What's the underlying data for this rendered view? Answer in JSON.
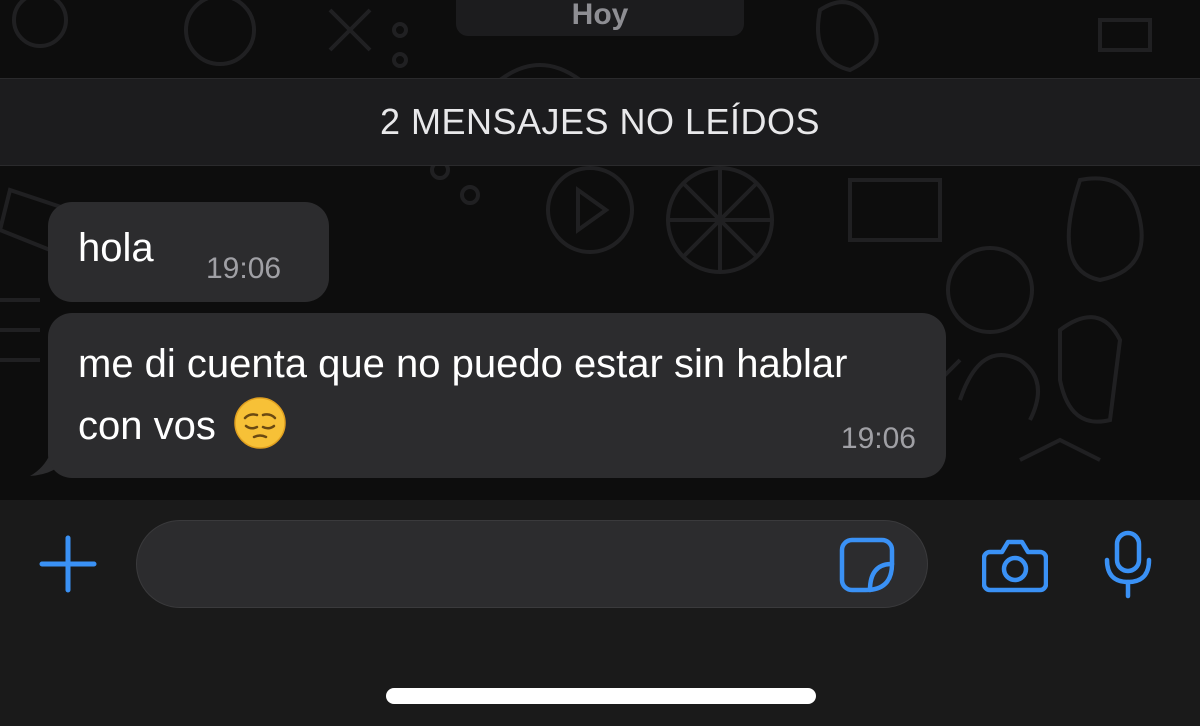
{
  "chat": {
    "date_label": "Hoy",
    "unread_banner": "2 MENSAJES NO LEÍDOS",
    "messages": [
      {
        "text": "hola",
        "time": "19:06",
        "direction": "incoming"
      },
      {
        "text": "me di cuenta que no puedo estar sin hablar con vos",
        "emoji": "pensive-face-emoji",
        "time": "19:06",
        "direction": "incoming"
      }
    ]
  },
  "input_bar": {
    "message_value": "",
    "icons": [
      "plus-icon",
      "sticker-icon",
      "camera-icon",
      "microphone-icon"
    ]
  },
  "colors": {
    "accent": "#3a91f5",
    "bubble": "#2c2c2e",
    "background": "#0d0d0d"
  }
}
